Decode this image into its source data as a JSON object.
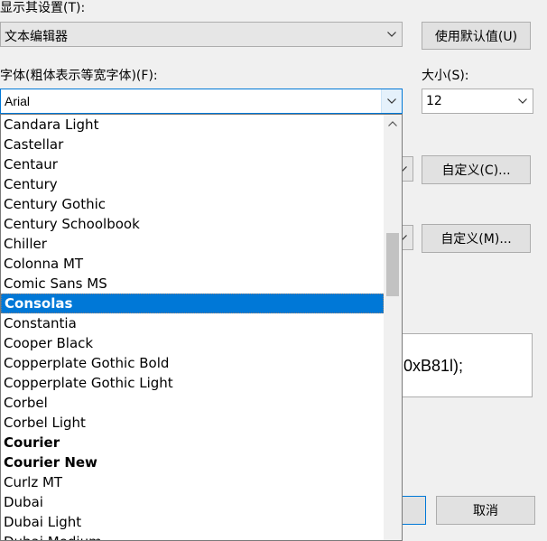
{
  "display_settings": {
    "label": "显示其设置(T):",
    "value": "文本编辑器",
    "use_defaults_button": "使用默认值(U)"
  },
  "font": {
    "label": "字体(粗体表示等宽字体)(F):",
    "value": "Arial"
  },
  "size": {
    "label": "大小(S):",
    "value": "12"
  },
  "custom_buttons": {
    "custom_c": "自定义(C)...",
    "custom_m": "自定义(M)..."
  },
  "preview": {
    "text": "0xB81l);"
  },
  "cancel_button": "取消",
  "font_list": [
    {
      "name": "Candara Light",
      "bold": false,
      "selected": false
    },
    {
      "name": "Castellar",
      "bold": false,
      "selected": false
    },
    {
      "name": "Centaur",
      "bold": false,
      "selected": false
    },
    {
      "name": "Century",
      "bold": false,
      "selected": false
    },
    {
      "name": "Century Gothic",
      "bold": false,
      "selected": false
    },
    {
      "name": "Century Schoolbook",
      "bold": false,
      "selected": false
    },
    {
      "name": "Chiller",
      "bold": false,
      "selected": false
    },
    {
      "name": "Colonna MT",
      "bold": false,
      "selected": false
    },
    {
      "name": "Comic Sans MS",
      "bold": false,
      "selected": false
    },
    {
      "name": "Consolas",
      "bold": true,
      "selected": true
    },
    {
      "name": "Constantia",
      "bold": false,
      "selected": false
    },
    {
      "name": "Cooper Black",
      "bold": false,
      "selected": false
    },
    {
      "name": "Copperplate Gothic Bold",
      "bold": false,
      "selected": false
    },
    {
      "name": "Copperplate Gothic Light",
      "bold": false,
      "selected": false
    },
    {
      "name": "Corbel",
      "bold": false,
      "selected": false
    },
    {
      "name": "Corbel Light",
      "bold": false,
      "selected": false
    },
    {
      "name": "Courier",
      "bold": true,
      "selected": false
    },
    {
      "name": "Courier New",
      "bold": true,
      "selected": false
    },
    {
      "name": "Curlz MT",
      "bold": false,
      "selected": false
    },
    {
      "name": "Dubai",
      "bold": false,
      "selected": false
    },
    {
      "name": "Dubai Light",
      "bold": false,
      "selected": false
    },
    {
      "name": "Dubai Medium",
      "bold": false,
      "selected": false
    }
  ],
  "colors": {
    "accent": "#0078d7",
    "window_bg": "#f0f0f0",
    "button_bg": "#e1e1e1",
    "border": "#adadad"
  },
  "icons": {
    "dropdown_arrow": "chevron-down-icon",
    "scroll_up": "chevron-up-icon"
  }
}
